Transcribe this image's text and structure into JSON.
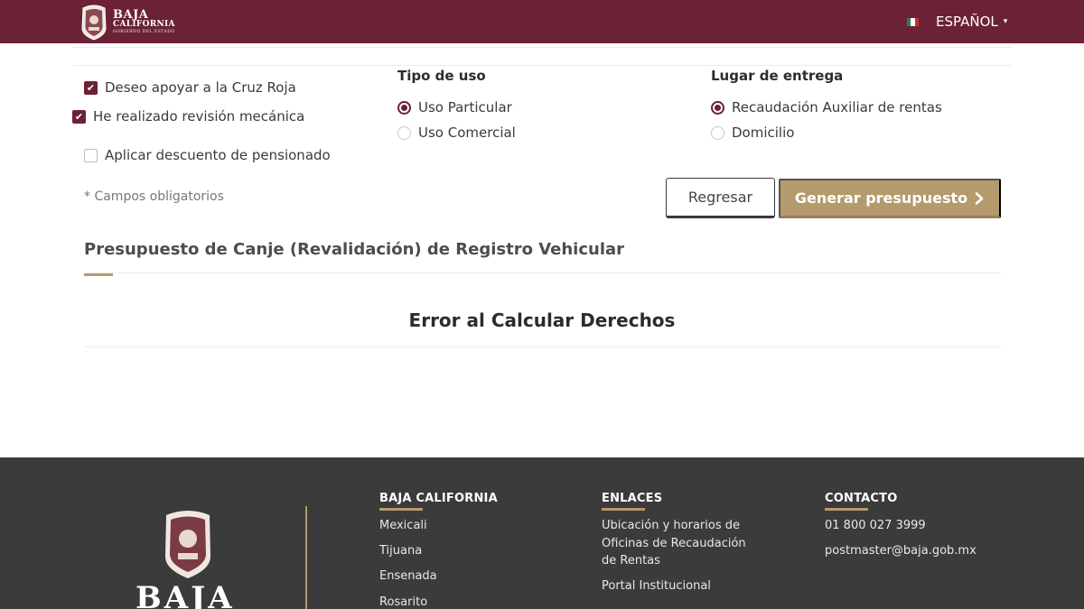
{
  "header": {
    "logo": {
      "line1": "BAJA",
      "line2": "CALIFORNIA",
      "line3": "GOBIERNO DEL ESTADO",
      "icon": "state-coat-of-arms"
    },
    "language": {
      "label": "ESPAÑOL",
      "flag": "mexico-flag-icon",
      "caret": "▾"
    }
  },
  "options": {
    "cruz_roja": {
      "label": "Deseo apoyar a la Cruz Roja",
      "checked": true
    },
    "revision": {
      "label": "He realizado revisión mecánica",
      "checked": true
    },
    "pensionado": {
      "label": "Aplicar descuento de pensionado",
      "checked": false
    }
  },
  "tipo_uso": {
    "heading": "Tipo de uso",
    "options": [
      {
        "label": "Uso Particular",
        "selected": true
      },
      {
        "label": "Uso Comercial",
        "selected": false
      }
    ]
  },
  "lugar_entrega": {
    "heading": "Lugar de entrega",
    "options": [
      {
        "label": "Recaudación Auxiliar de rentas",
        "selected": true
      },
      {
        "label": "Domicilio",
        "selected": false
      }
    ]
  },
  "required_note": "* Campos obligatorios",
  "buttons": {
    "back": "Regresar",
    "generate": "Generar presupuesto",
    "generate_icon": "chevron-right-icon"
  },
  "budget": {
    "title": "Presupuesto de Canje (Revalidación) de Registro Vehicular",
    "message": "Error al Calcular Derechos"
  },
  "footer": {
    "logo_text": "BAJA",
    "col1": {
      "heading": "BAJA CALIFORNIA",
      "links": [
        "Mexicali",
        "Tijuana",
        "Ensenada",
        "Rosarito"
      ]
    },
    "col2": {
      "heading": "ENLACES",
      "links": [
        "Ubicación y horarios de Oficinas de Recaudación de Rentas",
        "Portal Institucional"
      ]
    },
    "col3": {
      "heading": "CONTACTO",
      "links": [
        "01 800 027 3999",
        "postmaster@baja.gob.mx"
      ]
    }
  },
  "colors": {
    "brand": "#6b2136",
    "accent": "#b49a6c",
    "footer_bg": "#3b3b3b"
  }
}
